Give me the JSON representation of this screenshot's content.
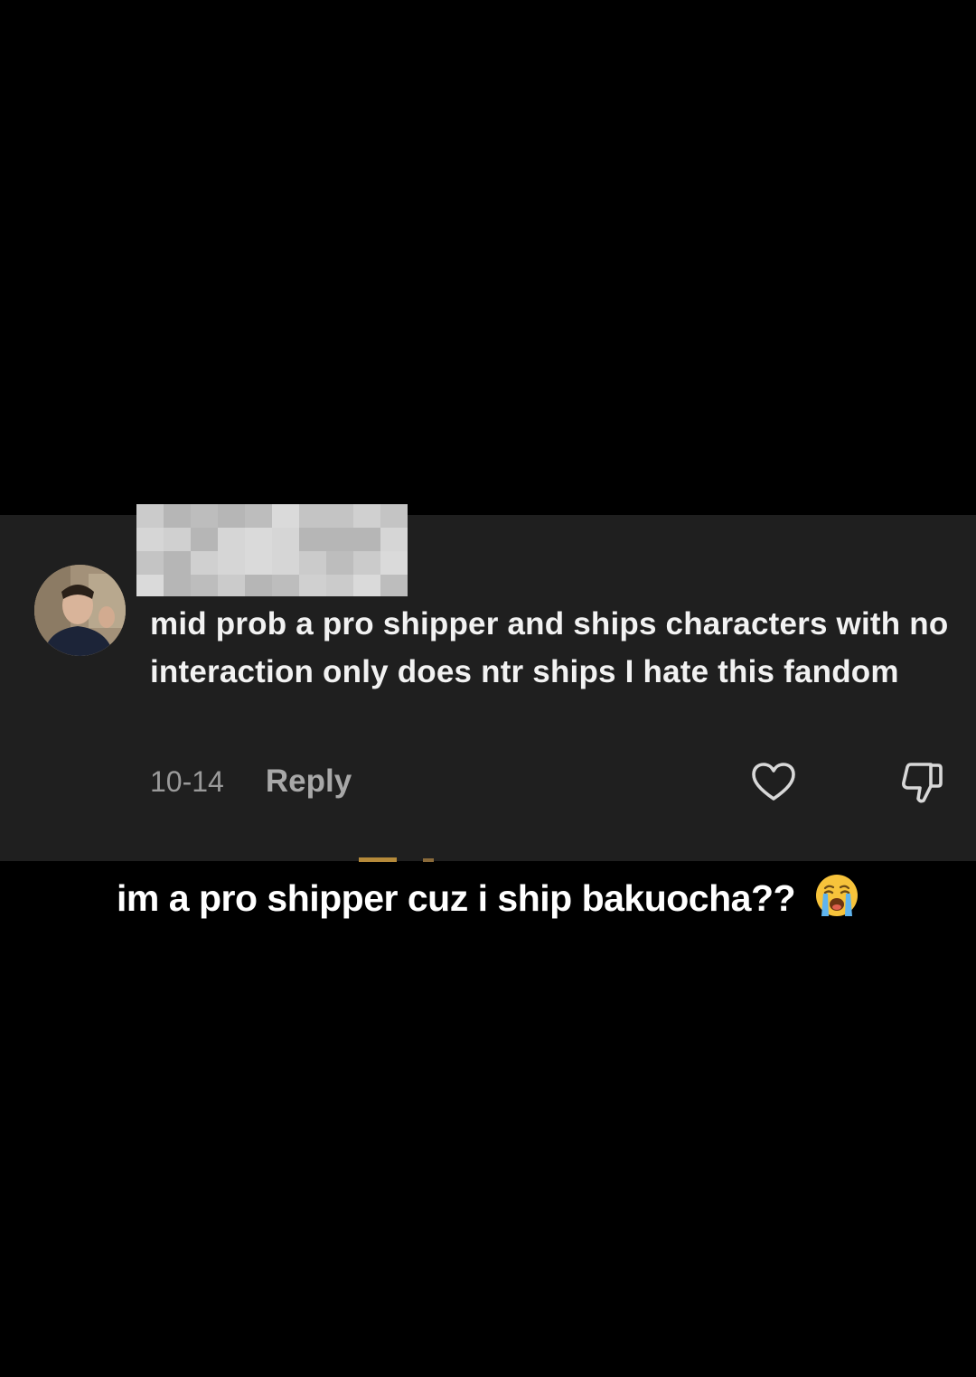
{
  "comment": {
    "username": "",
    "text": "mid prob a pro shipper and ships characters with no interaction only does ntr ships I hate this fandom",
    "date": "10-14",
    "reply_label": "Reply"
  },
  "caption": {
    "text": "im a pro shipper cuz i ship bakuocha??",
    "emoji": "loudly-crying-face"
  },
  "icons": {
    "like": "heart-outline-icon",
    "dislike": "thumbs-down-outline-icon"
  },
  "colors": {
    "background": "#000000",
    "card": "#1f1f1f",
    "text": "#f2f2f2",
    "muted": "#9a9a9a"
  }
}
